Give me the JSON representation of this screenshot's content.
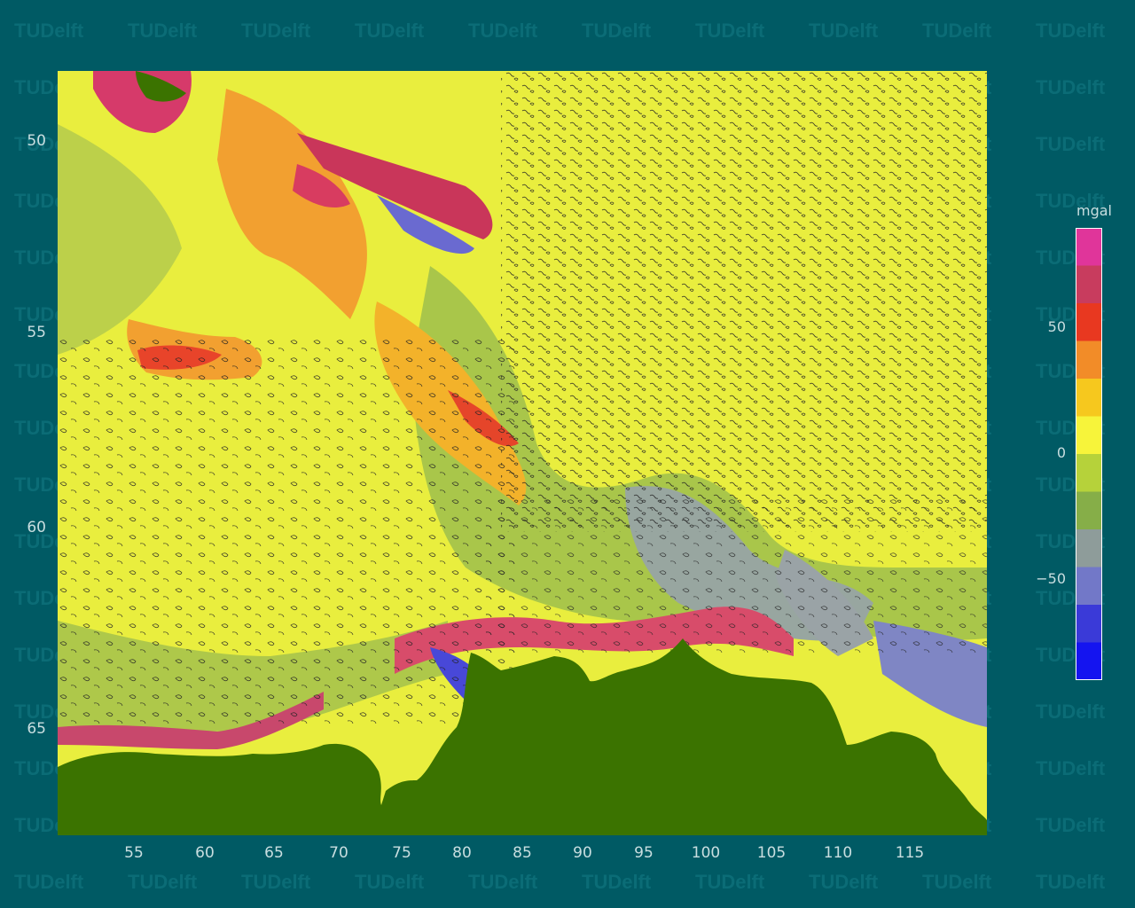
{
  "watermark": {
    "brand": "TUDelft"
  },
  "map": {
    "x_ticks": [
      "55",
      "60",
      "65",
      "70",
      "75",
      "80",
      "85",
      "90",
      "95",
      "100",
      "105",
      "110",
      "115"
    ],
    "y_ticks": [
      "50",
      "55",
      "60",
      "65"
    ],
    "land_color": "#3b7300"
  },
  "colorbar": {
    "unit": "mgal",
    "labels": [
      "50",
      "0",
      "−50"
    ],
    "colors_top_to_bottom": [
      "#e0359a",
      "#c83c5e",
      "#e83820",
      "#f28c28",
      "#f6c81e",
      "#f7f43a",
      "#b6d23a",
      "#86ae48",
      "#8e9c9a",
      "#7278c8",
      "#3a3ad8",
      "#1414f0"
    ]
  }
}
